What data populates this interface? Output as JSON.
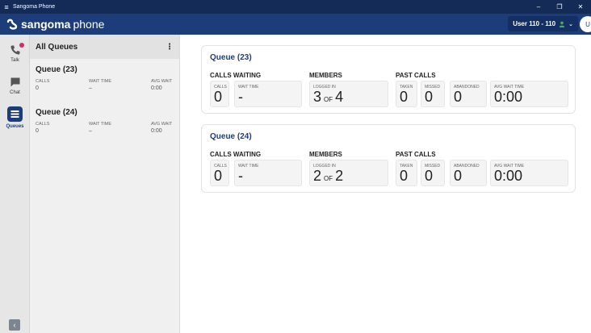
{
  "window": {
    "title": "Sangoma Phone",
    "menu_icon": "hamburger-icon",
    "controls": [
      "minimize-icon",
      "restore-icon",
      "close-icon"
    ]
  },
  "header": {
    "brand_part1": "sangoma",
    "brand_part2": "phone",
    "user_label": "User 110 - 110",
    "avatar_initial": "U",
    "colors": {
      "titlebar": "#142a57",
      "appbar": "#1d3d7a",
      "accent": "#1d3d7a",
      "presence": "#4caf50",
      "notification": "#d32b6c"
    }
  },
  "rail": {
    "items": [
      {
        "label": "Talk",
        "icon": "phone-icon",
        "has_notification": true
      },
      {
        "label": "Chat",
        "icon": "chat-icon"
      },
      {
        "label": "Queues",
        "icon": "queues-icon",
        "active": true
      }
    ],
    "collapse_icon": "chevron-left-icon"
  },
  "queue_panel": {
    "title": "All Queues",
    "menu_icon": "kebab-icon",
    "queues": [
      {
        "name": "Queue (23)",
        "h_calls": "CALLS",
        "h_wait": "WAIT TIME",
        "h_avg": "AVG WAIT",
        "calls": "0",
        "wait": "–",
        "avg": "0:00"
      },
      {
        "name": "Queue (24)",
        "h_calls": "CALLS",
        "h_wait": "WAIT TIME",
        "h_avg": "AVG WAIT",
        "calls": "0",
        "wait": "–",
        "avg": "0:00"
      }
    ]
  },
  "cards": [
    {
      "title": "Queue (23)",
      "calls_waiting": {
        "title": "CALLS WAITING",
        "calls_label": "CALLS",
        "calls": "0",
        "wait_label": "WAIT TIME",
        "wait": "-"
      },
      "members": {
        "title": "MEMBERS",
        "logged_label": "LOGGED IN",
        "logged": "3",
        "of": "OF",
        "total": "4"
      },
      "past_calls": {
        "title": "PAST CALLS",
        "taken_label": "TAKEN",
        "taken": "0",
        "missed_label": "MISSED",
        "missed": "0",
        "abandoned_label": "ABANDONED",
        "abandoned": "0",
        "avg_label": "AVG WAIT TIME",
        "avg": "0:00"
      }
    },
    {
      "title": "Queue (24)",
      "calls_waiting": {
        "title": "CALLS WAITING",
        "calls_label": "CALLS",
        "calls": "0",
        "wait_label": "WAIT TIME",
        "wait": "-"
      },
      "members": {
        "title": "MEMBERS",
        "logged_label": "LOGGED IN",
        "logged": "2",
        "of": "OF",
        "total": "2"
      },
      "past_calls": {
        "title": "PAST CALLS",
        "taken_label": "TAKEN",
        "taken": "0",
        "missed_label": "MISSED",
        "missed": "0",
        "abandoned_label": "ABANDONED",
        "abandoned": "0",
        "avg_label": "AVG WAIT TIME",
        "avg": "0:00"
      }
    }
  ]
}
